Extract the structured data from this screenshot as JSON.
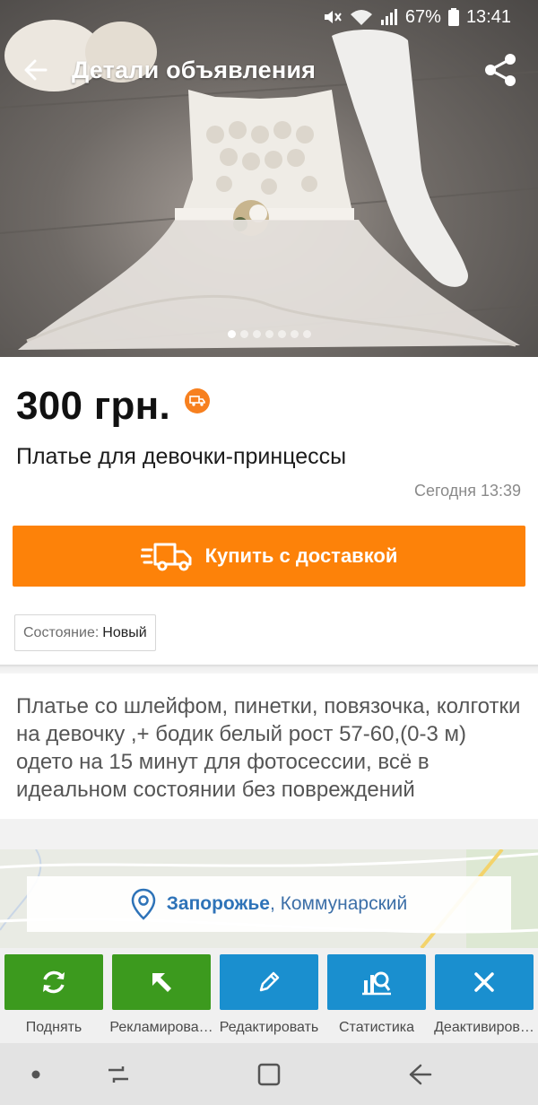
{
  "status_bar": {
    "battery": "67%",
    "time": "13:41"
  },
  "header": {
    "title": "Детали объявления"
  },
  "gallery": {
    "count": 7,
    "active_index": 0
  },
  "listing": {
    "price": "300 грн.",
    "title": "Платье для девочки-принцессы",
    "date": "Сегодня 13:39",
    "buy_button": "Купить с доставкой",
    "condition_label": "Состояние:",
    "condition_value": "Новый",
    "description": "Платье со шлейфом, пинетки, повязочка, колготки на девочку ,+ бодик белый рост 57-60,(0-3 м)  одето на 15 минут для фотосессии, всё в идеальном состоянии без повреждений"
  },
  "location": {
    "city": "Запорожье",
    "district": ", Коммунарский"
  },
  "actions": [
    {
      "label": "Поднять",
      "icon": "refresh-icon",
      "color": "#3c9a1e"
    },
    {
      "label": "Рекламирова…",
      "icon": "arrow-up-left-icon",
      "color": "#3c9a1e"
    },
    {
      "label": "Редактировать",
      "icon": "pencil-icon",
      "color": "#1a8fcf"
    },
    {
      "label": "Статистика",
      "icon": "stats-icon",
      "color": "#1a8fcf"
    },
    {
      "label": "Деактивиров…",
      "icon": "close-icon",
      "color": "#1a8fcf"
    }
  ],
  "colors": {
    "accent_orange": "#fd8209",
    "green": "#3c9a1e",
    "blue": "#1a8fcf",
    "link_blue": "#2e73b8"
  }
}
